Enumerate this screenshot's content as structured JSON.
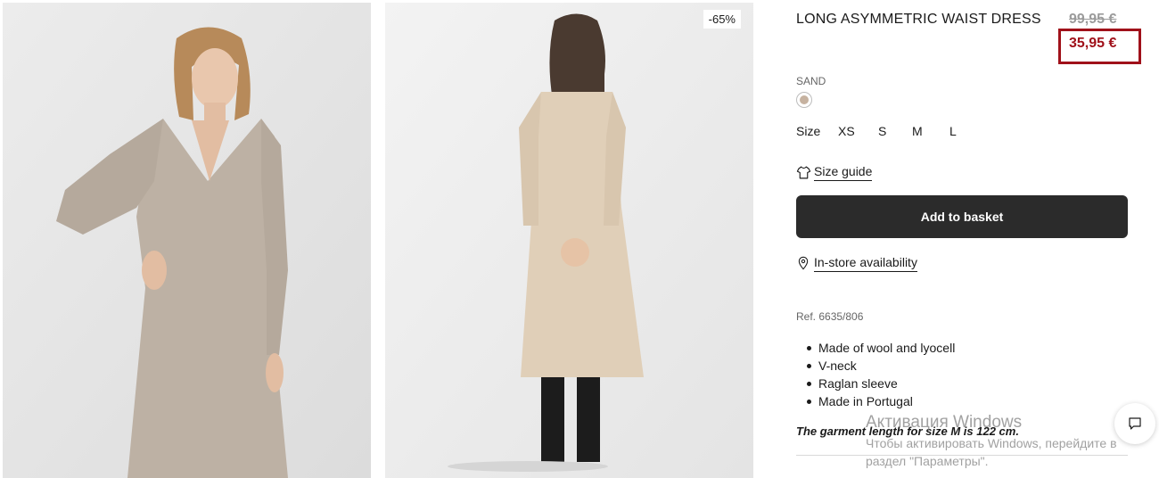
{
  "product": {
    "title": "LONG ASYMMETRIC WAIST DRESS",
    "old_price": "99,95 €",
    "new_price": "35,95 €",
    "discount_badge": "-65%",
    "color_name": "SAND",
    "color_hex": "#c6b2a0",
    "size_label": "Size",
    "sizes": [
      "XS",
      "S",
      "M",
      "L"
    ],
    "size_guide_label": "Size guide",
    "add_to_basket_label": "Add to basket",
    "in_store_label": "In-store availability",
    "ref": "Ref. 6635/806",
    "features": [
      "Made of wool and lyocell",
      "V-neck",
      "Raglan sleeve",
      "Made in Portugal"
    ],
    "garment_note": "The garment length for size M is 122 cm."
  },
  "windows_watermark": {
    "title": "Активация Windows",
    "subtitle": "Чтобы активировать Windows, перейдите в раздел \"Параметры\"."
  },
  "colors": {
    "price_accent": "#a0111a",
    "button_bg": "#2b2b2b"
  },
  "icons": {
    "size_guide": "tshirt-icon",
    "store": "location-pin-icon",
    "chat": "chat-bubble-icon"
  }
}
